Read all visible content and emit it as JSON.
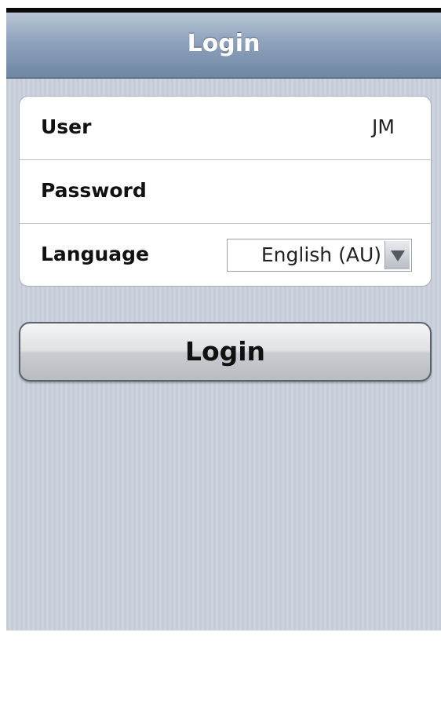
{
  "header": {
    "title": "Login"
  },
  "form": {
    "user": {
      "label": "User",
      "value": "JM"
    },
    "password": {
      "label": "Password",
      "value": ""
    },
    "language": {
      "label": "Language",
      "selected": "English (AU)"
    }
  },
  "actions": {
    "login_label": "Login"
  },
  "icons": {
    "language_dropdown": "chevron-down-icon"
  },
  "colors": {
    "titlebar": "#7f95b1",
    "background": "#c9cfda",
    "card": "#ffffff"
  }
}
